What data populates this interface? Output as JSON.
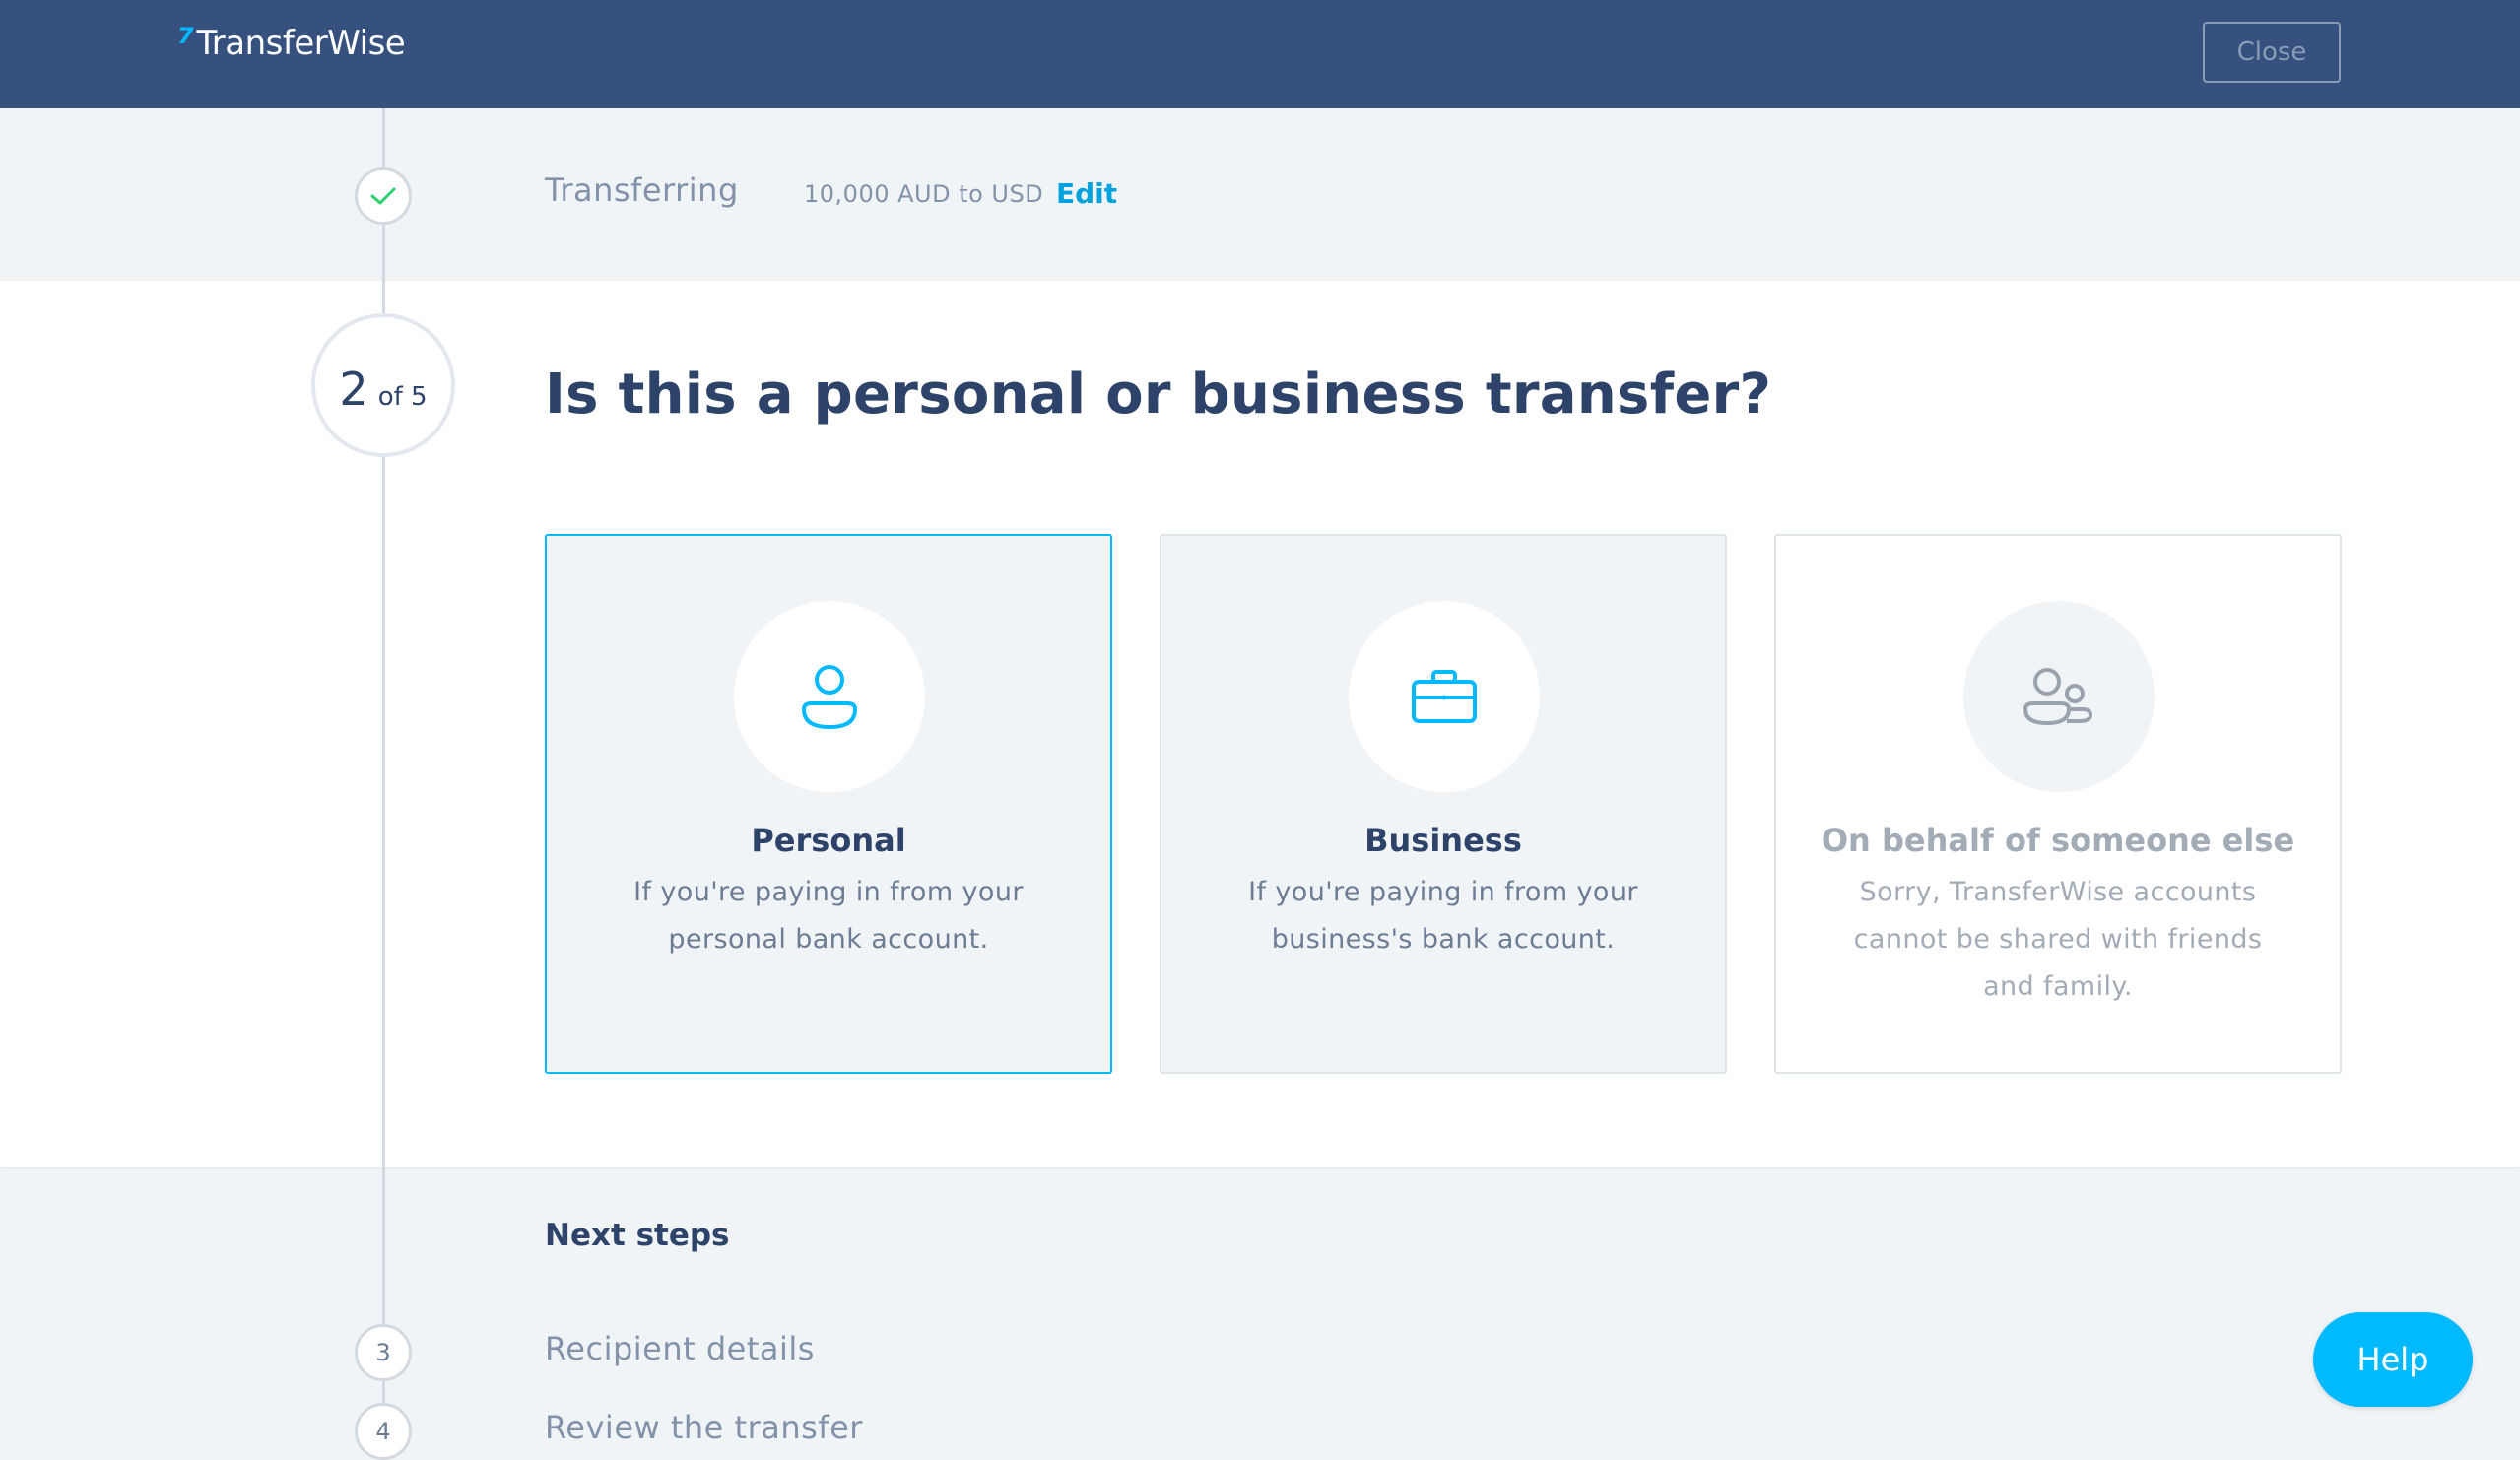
{
  "header": {
    "logo_mark": "⁷7",
    "logo_text": "TransferWise",
    "close_label": "Close"
  },
  "completed_step": {
    "label": "Transferring",
    "summary": "10,000 AUD to USD",
    "edit_label": "Edit"
  },
  "current_step": {
    "number": "2",
    "of_total": "of 5",
    "question": "Is this a personal or business transfer?"
  },
  "options": [
    {
      "title": "Personal",
      "description": "If you're paying in from your personal bank account.",
      "icon": "person-icon",
      "selected": true,
      "enabled": true
    },
    {
      "title": "Business",
      "description": "If you're paying in from your business's bank account.",
      "icon": "briefcase-icon",
      "selected": false,
      "enabled": true
    },
    {
      "title": "On behalf of someone else",
      "description": "Sorry, TransferWise accounts cannot be shared with friends and family.",
      "icon": "two-people-icon",
      "selected": false,
      "enabled": false
    }
  ],
  "next_steps": {
    "heading": "Next steps",
    "steps": [
      {
        "number": "3",
        "label": "Recipient details"
      },
      {
        "number": "4",
        "label": "Review the transfer"
      }
    ]
  },
  "help_label": "Help",
  "colors": {
    "header_bg": "#37517e",
    "accent": "#00b9ff",
    "link": "#00a2dd",
    "check": "#2ed06e",
    "text_dark": "#2e4369",
    "text_muted": "#8192a9",
    "panel_bg": "#f1f4f7"
  }
}
